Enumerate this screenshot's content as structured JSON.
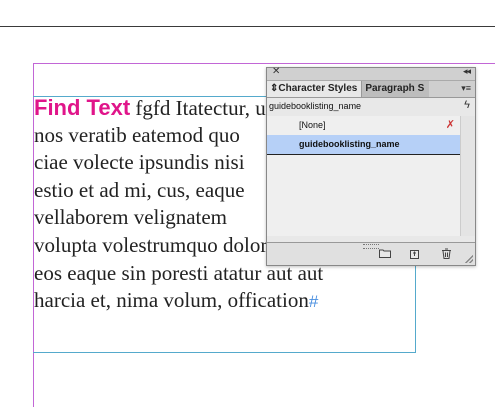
{
  "document": {
    "lines": [
      {
        "highlight": "Find Text",
        "rest": " fgfd Itatectur, ut"
      },
      {
        "text": "nos veratib eatemod quo"
      },
      {
        "text": "ciae volecte ipsundis nisi"
      },
      {
        "text": "estio et ad mi, cus, eaque"
      },
      {
        "text": "vellaborem velignatem"
      },
      {
        "text": "volupta volestrumquo dolorpos aut"
      },
      {
        "text": "eos eaque sin poresti atatur aut aut"
      },
      {
        "text": "harcia et, nima volum, offication",
        "end_mark": "#"
      }
    ],
    "highlight_color": "#e0158a"
  },
  "panel": {
    "tabs": [
      {
        "label": "Character Styles",
        "active": true
      },
      {
        "label": "Paragraph S",
        "active": false
      }
    ],
    "current_style": "guidebooklisting_name",
    "styles": [
      {
        "label": "[None]",
        "selected": false
      },
      {
        "label": "guidebooklisting_name",
        "selected": true
      }
    ],
    "icons": {
      "close": "close-icon",
      "collapse": "collapse-icon",
      "menu": "panel-menu-icon",
      "quick_apply": "lightning-icon",
      "override": "clear-override-icon",
      "folder": "new-style-group-icon",
      "new": "new-style-icon",
      "delete": "trash-icon"
    },
    "selection_color": "#b6d0f7"
  }
}
